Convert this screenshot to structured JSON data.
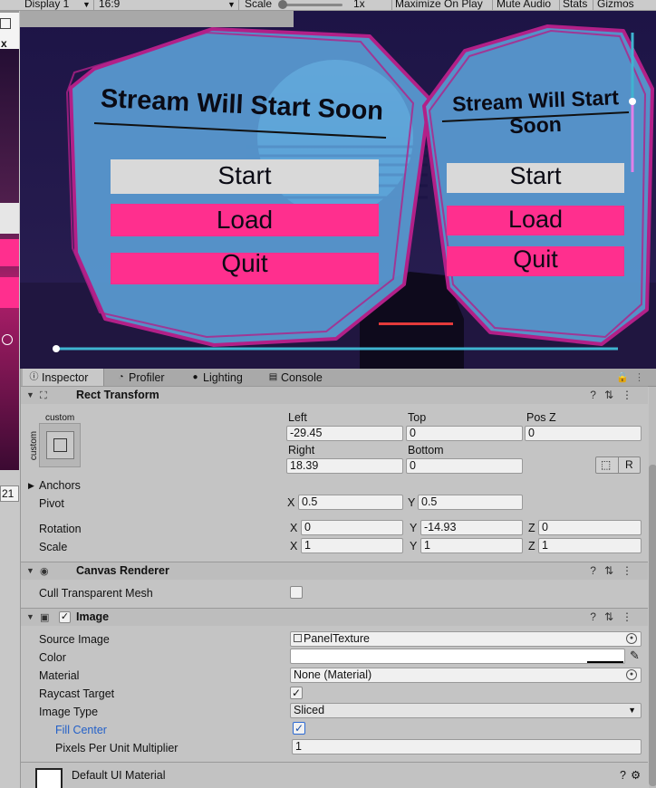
{
  "game_toolbar": {
    "display": "Display 1",
    "aspect": "16:9",
    "scale_label": "Scale",
    "scale_value": "1x",
    "maximize": "Maximize On Play",
    "mute": "Mute Audio",
    "stats": "Stats",
    "gizmos": "Gizmos"
  },
  "left_strip": {
    "x_label": "x",
    "coord": "21"
  },
  "game_ui": {
    "left_panel": {
      "title": "Stream Will Start Soon",
      "buttons": [
        "Start",
        "Load",
        "Quit"
      ]
    },
    "right_panel": {
      "title_line1": "Stream Will Start",
      "title_line2": "Soon",
      "buttons": [
        "Start",
        "Load",
        "Quit"
      ]
    },
    "colors": {
      "panel_fill": "#5b9fd6",
      "panel_border": "#b22088",
      "start_button": "#d9d9d9",
      "pink_button": "#ff2f8e",
      "sun": "#86e5f2"
    }
  },
  "tabs": {
    "inspector": "Inspector",
    "profiler": "Profiler",
    "lighting": "Lighting",
    "console": "Console"
  },
  "rect_transform": {
    "title": "Rect Transform",
    "preset_label": "custom",
    "preset_side": "custom",
    "left_label": "Left",
    "left_value": "-29.45",
    "top_label": "Top",
    "top_value": "0",
    "posz_label": "Pos Z",
    "posz_value": "0",
    "right_label": "Right",
    "right_value": "18.39",
    "bottom_label": "Bottom",
    "bottom_value": "0",
    "r_button": "R",
    "anchors_label": "Anchors",
    "pivot_label": "Pivot",
    "pivot_x": "0.5",
    "pivot_y": "0.5",
    "rotation_label": "Rotation",
    "rotation_x": "0",
    "rotation_y": "-14.93",
    "rotation_z": "0",
    "scale_label": "Scale",
    "scale_x": "1",
    "scale_y": "1",
    "scale_z": "1",
    "x": "X",
    "y": "Y",
    "z": "Z"
  },
  "canvas_renderer": {
    "title": "Canvas Renderer",
    "cull_label": "Cull Transparent Mesh"
  },
  "image": {
    "title": "Image",
    "source_label": "Source Image",
    "source_value": "PanelTexture",
    "color_label": "Color",
    "material_label": "Material",
    "material_value": "None (Material)",
    "raycast_label": "Raycast Target",
    "image_type_label": "Image Type",
    "image_type_value": "Sliced",
    "fill_center_label": "Fill Center",
    "ppu_label": "Pixels Per Unit Multiplier",
    "ppu_value": "1",
    "check": "✓"
  },
  "material_footer": {
    "title": "Default UI Material"
  }
}
